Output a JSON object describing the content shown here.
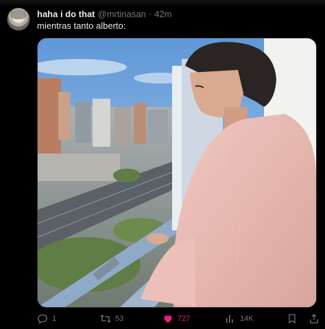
{
  "tweet": {
    "author_name": "haha i do that",
    "handle": "@mrtinasan",
    "separator": "·",
    "time": "42m",
    "text": "mientras tanto alberto:"
  },
  "actions": {
    "reply_count": "1",
    "retweet_count": "53",
    "like_count": "727",
    "views_count": "14K"
  },
  "colors": {
    "like_active": "#f91880",
    "muted": "#71767b",
    "background": "#000000"
  },
  "icons": {
    "reply": "reply-icon",
    "retweet": "retweet-icon",
    "like": "heart-filled-icon",
    "views": "bar-chart-icon",
    "bookmark": "bookmark-icon",
    "share": "share-icon"
  }
}
